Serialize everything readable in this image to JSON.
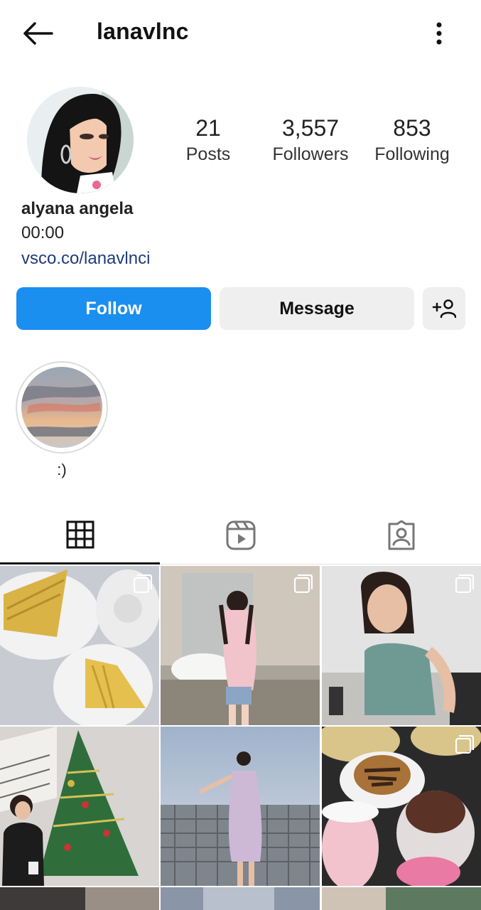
{
  "header": {
    "username": "lanavlnc",
    "back_icon": "arrow-left-icon",
    "more_icon": "more-vertical-icon"
  },
  "profile": {
    "full_name": "alyana angela",
    "bio": "00:00",
    "link": "vsco.co/lanavlnci",
    "stats": [
      {
        "count": "21",
        "label": "Posts"
      },
      {
        "count": "3,557",
        "label": "Followers"
      },
      {
        "count": "853",
        "label": "Following"
      }
    ]
  },
  "actions": {
    "follow_label": "Follow",
    "message_label": "Message",
    "add_icon": "add-user-icon"
  },
  "highlights": [
    {
      "label": ":)"
    }
  ],
  "tabs": [
    {
      "icon": "grid-icon"
    },
    {
      "icon": "reels-icon"
    },
    {
      "icon": "tagged-icon"
    }
  ],
  "colors": {
    "follow_button": "#1a8fef",
    "link": "#1f3c78"
  }
}
